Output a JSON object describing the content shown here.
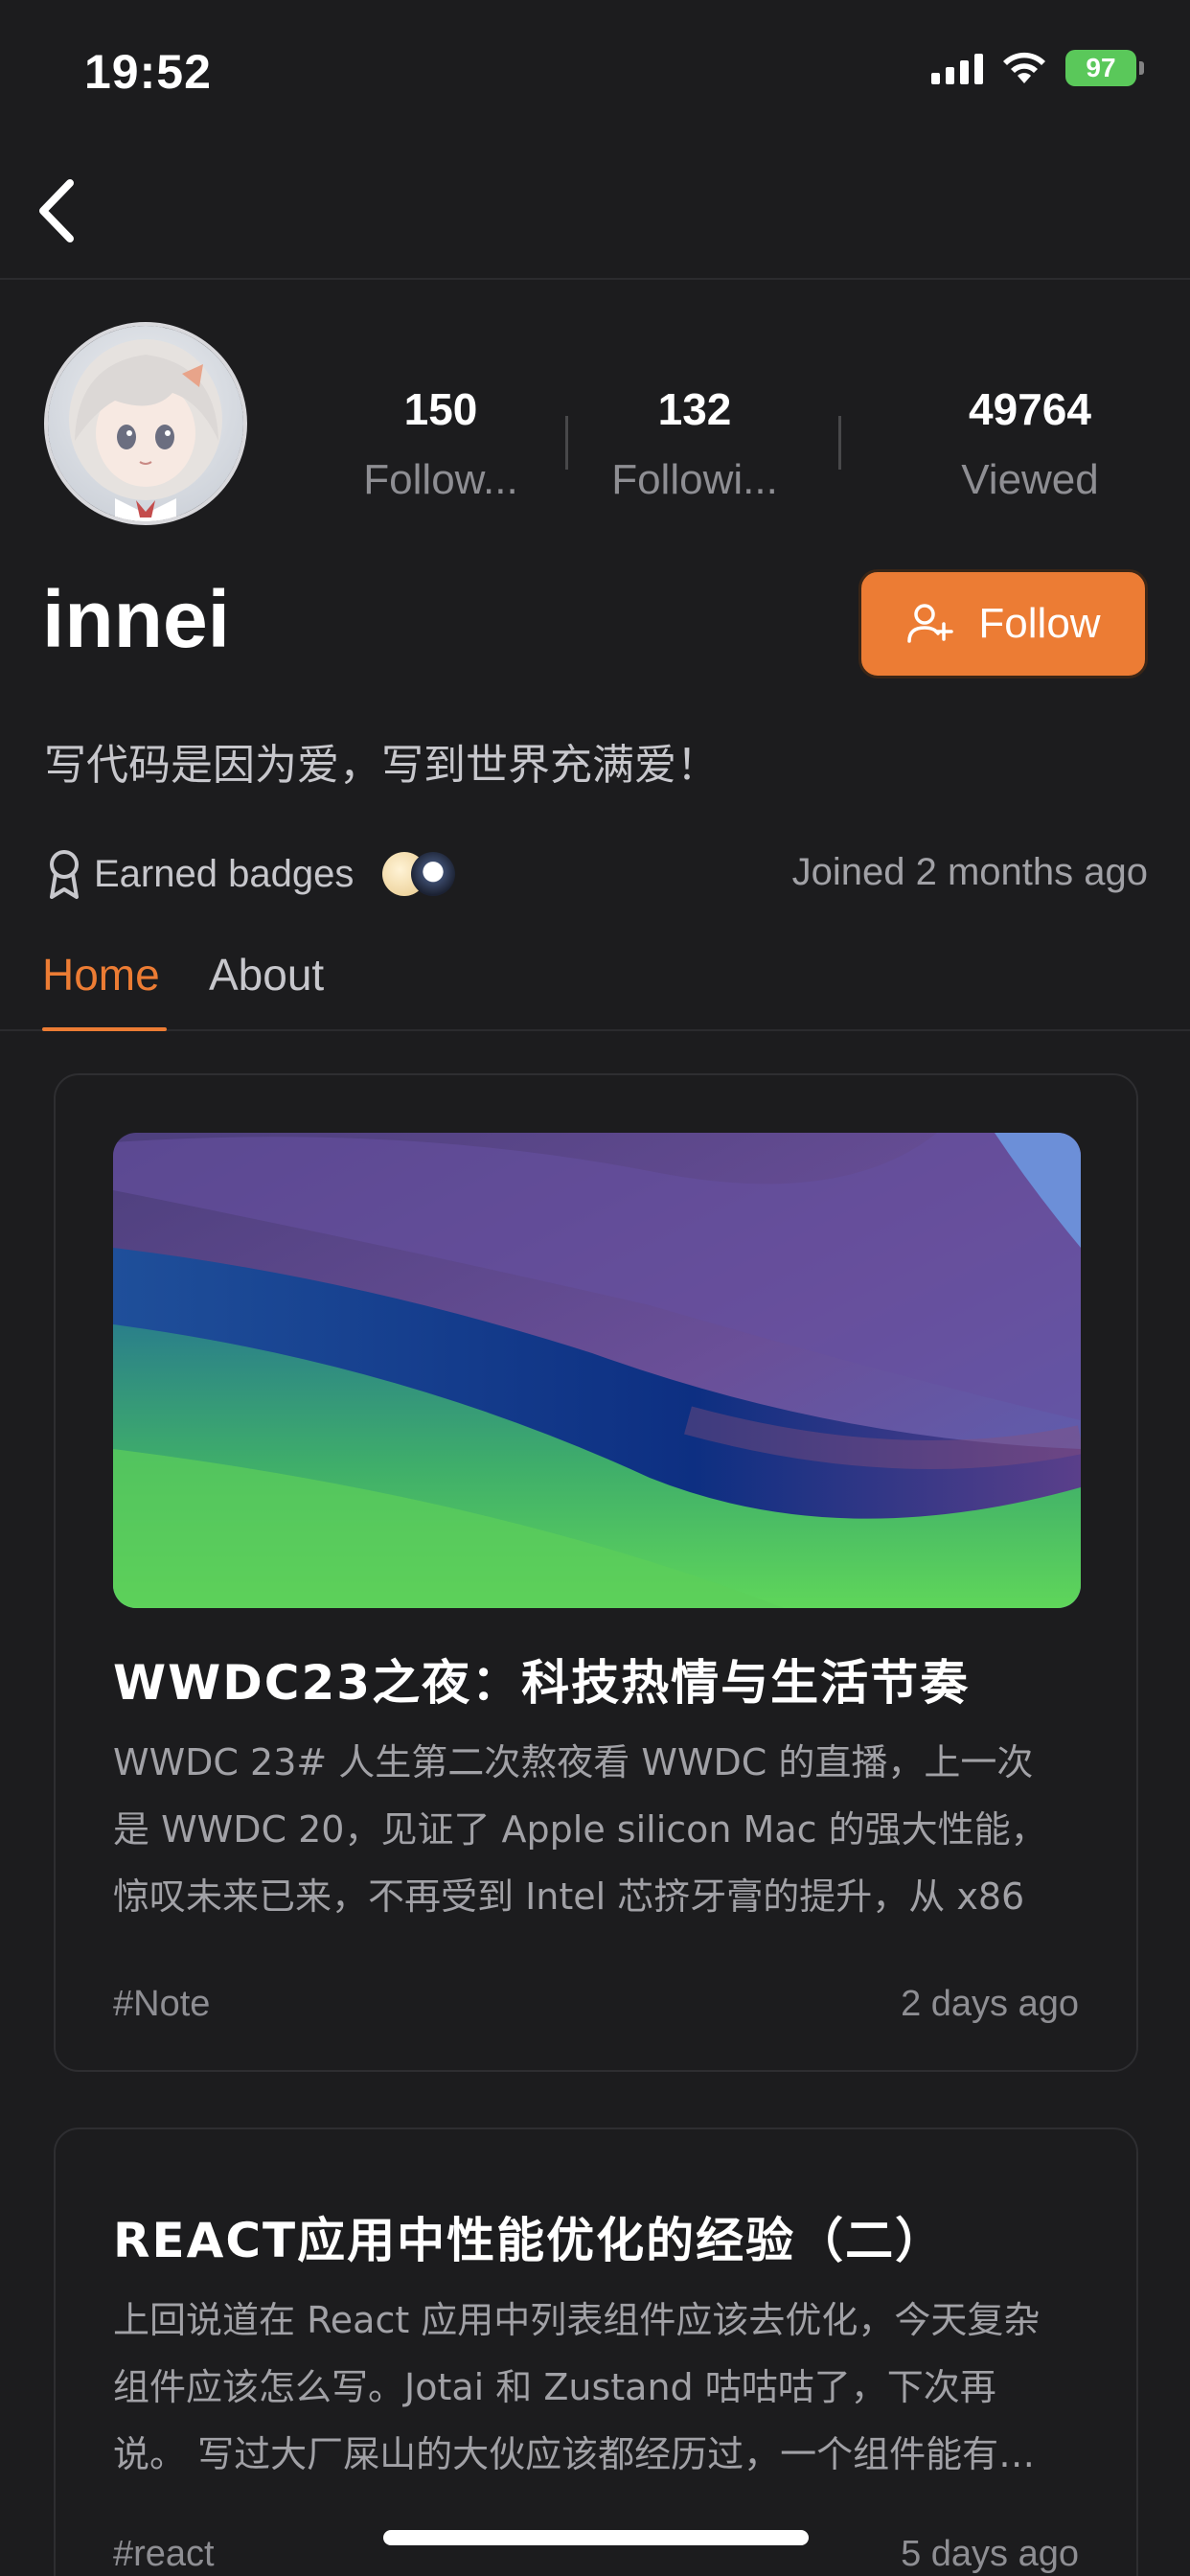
{
  "status_bar": {
    "time": "19:52",
    "battery": "97"
  },
  "profile": {
    "username": "innei",
    "bio": "写代码是因为爱，写到世界充满爱！",
    "stats": [
      {
        "value": "150",
        "label": "Follow..."
      },
      {
        "value": "132",
        "label": "Followi..."
      },
      {
        "value": "49764",
        "label": "Viewed"
      }
    ],
    "follow_label": "Follow",
    "badges_label": "Earned badges",
    "joined": "Joined 2 months ago"
  },
  "tabs": [
    {
      "label": "Home",
      "active": true
    },
    {
      "label": "About",
      "active": false
    }
  ],
  "posts": [
    {
      "title": "WWDC23之夜：科技热情与生活节奏",
      "excerpt_lines": [
        "WWDC 23# 人生第二次熬夜看 WWDC 的直播，上一次",
        "是 WWDC 20，见证了 Apple silicon Mac 的强大性能，",
        "惊叹未来已来，不再受到 Intel 芯挤牙膏的提升，从 x86"
      ],
      "tag": "#Note",
      "date": "2 days ago"
    },
    {
      "title": "REACT应用中性能优化的经验（二）",
      "excerpt_lines": [
        "上回说道在 React 应用中列表组件应该去优化，今天复杂",
        "组件应该怎么写。Jotai 和 Zustand 咕咕咕了，下次再",
        "说。 写过大厂屎山的大伙应该都经历过，一个组件能有…"
      ],
      "tag": "#react",
      "date": "5 days ago"
    }
  ],
  "colors": {
    "accent": "#ec7c34",
    "background": "#1c1c1e",
    "battery": "#5ac85a"
  }
}
